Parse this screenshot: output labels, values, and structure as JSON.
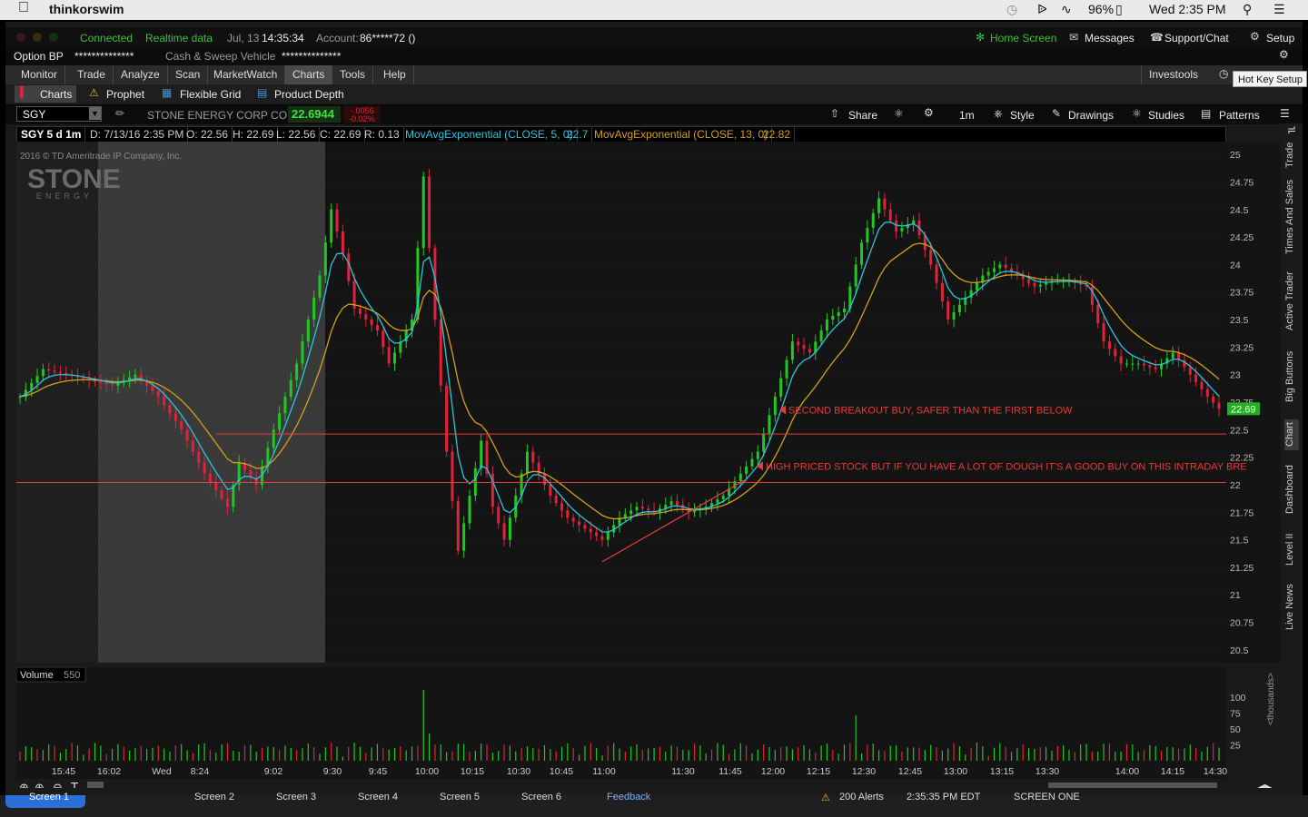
{
  "mac_menu": {
    "app_name": "thinkorswim",
    "battery": "96%",
    "clock": "Wed 2:35 PM"
  },
  "status_bar": {
    "connected": "Connected",
    "data_mode": "Realtime data",
    "date": "Jul, 13",
    "time": "14:35:34",
    "account_label": "Account:",
    "account_value": "86*****72 ()",
    "home_screen": "Home Screen",
    "messages": "Messages",
    "support": "Support/Chat",
    "setup": "Setup"
  },
  "balances": {
    "option_bp_label": "Option BP",
    "option_bp_value": "**************",
    "cash_label": "Cash & Sweep Vehicle",
    "cash_value": "**************"
  },
  "main_tabs": [
    "Monitor",
    "Trade",
    "Analyze",
    "Scan",
    "MarketWatch",
    "Charts",
    "Tools",
    "Help"
  ],
  "selected_tab": "Charts",
  "investools": "Investools",
  "hotkey_tooltip": "Hot Key Setup",
  "sub_tabs": [
    "Charts",
    "Prophet",
    "Flexible Grid",
    "Product Depth"
  ],
  "symbol_bar": {
    "symbol": "SGY",
    "company": "STONE ENERGY CORP COM",
    "last": "22.6944",
    "change": "-.0056",
    "change_pct": "-0.02%",
    "share": "Share",
    "timeframe": "1m",
    "style": "Style",
    "drawings": "Drawings",
    "studies": "Studies",
    "patterns": "Patterns"
  },
  "info_stripe": {
    "title": "SGY 5 d 1m",
    "date": "D: 7/13/16 2:35 PM",
    "open": "O: 22.56",
    "high": "H: 22.69",
    "low": "L: 22.56",
    "close": "C: 22.69",
    "range": "R: 0.13",
    "ema5_label": "MovAvgExponential (CLOSE, 5, 0)",
    "ema5_value": "22.7",
    "ema13_label": "MovAvgExponential (CLOSE, 13, 0)",
    "ema13_value": "22.82"
  },
  "copyright": "2016 © TD Ameritrade IP Company, Inc.",
  "logo_text": "STONE",
  "logo_sub": "ENERGY",
  "volume_label": "Volume",
  "volume_value": "550",
  "volume_unit": "<thousands>",
  "annotations": {
    "upper": "SECOND BREAKOUT BUY, SAFER THAN THE FIRST BELOW",
    "lower": "HIGH PRICED STOCK BUT IF YOU HAVE A LOT OF DOUGH IT'S A GOOD BUY ON THIS INTRADAY BRE"
  },
  "side_tabs": [
    "Trade",
    "Times And Sales",
    "Active Trader",
    "Big Buttons",
    "Chart",
    "Dashboard",
    "Level II",
    "Live News"
  ],
  "bottom_tabs": [
    "Screen 1",
    "Screen 2",
    "Screen 3",
    "Screen 4",
    "Screen 5",
    "Screen 6",
    "Feedback"
  ],
  "bottom_status": {
    "alerts": "200 Alerts",
    "clock": "2:35:35 PM EDT",
    "screen": "SCREEN ONE"
  },
  "colors": {
    "ema5": "#27c6e0",
    "ema13": "#d4a017",
    "up": "#22c822",
    "down": "#e0223a",
    "annotation": "#e83a3a"
  },
  "chart_data": {
    "type": "candlestick",
    "symbol": "SGY",
    "aggregation": "1m",
    "ylim": [
      20.4,
      25.1
    ],
    "y_ticks": [
      25,
      24.75,
      24.5,
      24.25,
      24,
      23.75,
      23.5,
      23.25,
      23,
      22.75,
      22.5,
      22.25,
      22,
      21.75,
      21.5,
      21.25,
      21,
      20.75,
      20.5
    ],
    "last_price_label": "22.69",
    "x_ticks": [
      "15:45",
      "16:02",
      "Wed",
      "8:24",
      "9:02",
      "9:30",
      "9:45",
      "10:00",
      "10:15",
      "10:30",
      "10:45",
      "11:00",
      "11:30",
      "11:45",
      "12:00",
      "12:15",
      "12:30",
      "12:45",
      "13:00",
      "13:15",
      "13:30",
      "14:00",
      "14:15",
      "14:30"
    ],
    "volume_ticks": [
      100,
      75,
      50,
      25
    ],
    "horizontal_lines": [
      22.46,
      22.02
    ],
    "trendline": {
      "from": [
        10.5,
        21.3
      ],
      "to": [
        12.55,
        22.05
      ]
    },
    "close_path": [
      [
        0,
        22.8
      ],
      [
        4,
        23.05
      ],
      [
        8,
        23.0
      ],
      [
        12,
        22.95
      ],
      [
        16,
        22.9
      ],
      [
        20,
        23.0
      ],
      [
        24,
        22.8
      ],
      [
        28,
        22.5
      ],
      [
        32,
        22.1
      ],
      [
        36,
        21.8
      ],
      [
        38,
        22.2
      ],
      [
        41,
        22.0
      ],
      [
        44,
        22.5
      ],
      [
        48,
        23.1
      ],
      [
        52,
        23.9
      ],
      [
        54,
        24.5
      ],
      [
        56,
        24.1
      ],
      [
        58,
        23.6
      ],
      [
        60,
        23.5
      ],
      [
        62,
        23.4
      ],
      [
        64,
        23.1
      ],
      [
        66,
        23.3
      ],
      [
        68,
        23.5
      ],
      [
        70,
        24.8
      ],
      [
        72,
        23.5
      ],
      [
        74,
        22.3
      ],
      [
        76,
        21.4
      ],
      [
        78,
        21.9
      ],
      [
        80,
        22.4
      ],
      [
        82,
        21.8
      ],
      [
        84,
        21.5
      ],
      [
        86,
        21.9
      ],
      [
        88,
        22.3
      ],
      [
        90,
        22.1
      ],
      [
        92,
        21.9
      ],
      [
        95,
        21.7
      ],
      [
        98,
        21.6
      ],
      [
        101,
        21.5
      ],
      [
        104,
        21.7
      ],
      [
        107,
        21.8
      ],
      [
        110,
        21.75
      ],
      [
        113,
        21.85
      ],
      [
        116,
        21.75
      ],
      [
        119,
        21.8
      ],
      [
        122,
        21.9
      ],
      [
        125,
        22.1
      ],
      [
        128,
        22.3
      ],
      [
        131,
        22.8
      ],
      [
        134,
        23.3
      ],
      [
        137,
        23.2
      ],
      [
        140,
        23.5
      ],
      [
        143,
        23.6
      ],
      [
        146,
        24.2
      ],
      [
        149,
        24.6
      ],
      [
        152,
        24.3
      ],
      [
        155,
        24.4
      ],
      [
        158,
        24.0
      ],
      [
        161,
        23.5
      ],
      [
        164,
        23.7
      ],
      [
        167,
        23.9
      ],
      [
        170,
        24.0
      ],
      [
        173,
        23.9
      ],
      [
        176,
        23.8
      ],
      [
        179,
        23.85
      ],
      [
        182,
        23.85
      ],
      [
        185,
        23.8
      ],
      [
        188,
        23.3
      ],
      [
        191,
        23.1
      ],
      [
        194,
        23.1
      ],
      [
        197,
        23.05
      ],
      [
        200,
        23.2
      ],
      [
        203,
        23.0
      ],
      [
        206,
        22.8
      ],
      [
        208,
        22.69
      ]
    ]
  }
}
